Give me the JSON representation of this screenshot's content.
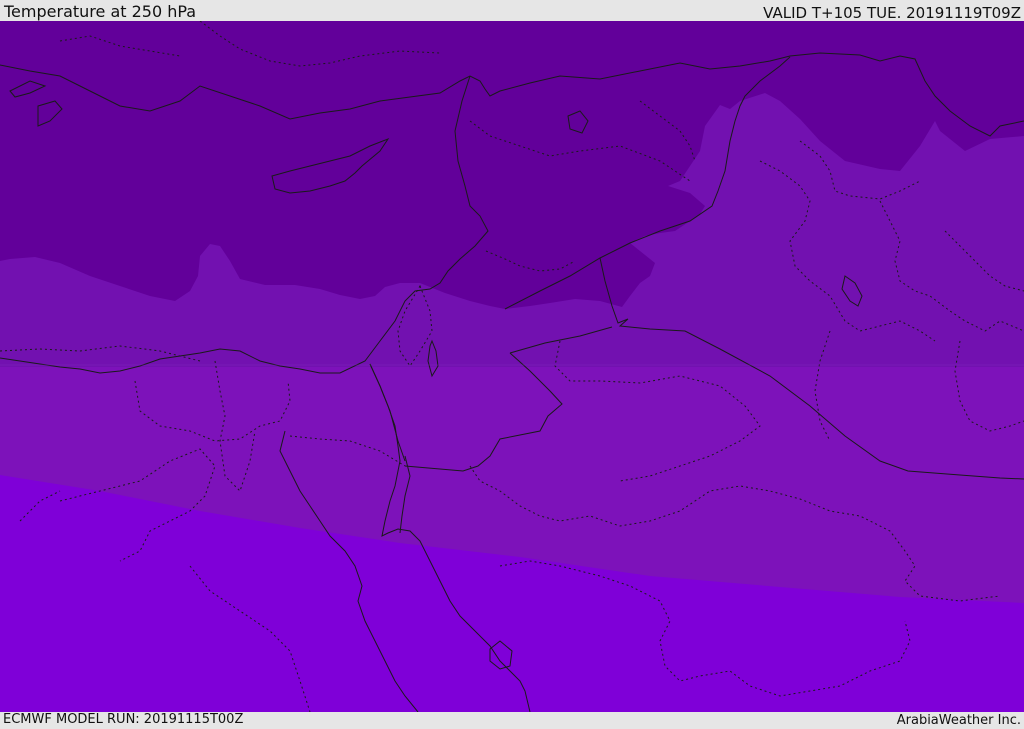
{
  "header": {
    "title": "Temperature at 250 hPa",
    "valid_time": "VALID T+105 TUE. 20191119T09Z"
  },
  "footer": {
    "model_run": "ECMWF MODEL RUN: 20191115T00Z",
    "credit": "ArabiaWeather Inc."
  },
  "map": {
    "region": "Eastern Mediterranean and Middle East",
    "field_bands": [
      {
        "name": "coldest",
        "color": "#62009a"
      },
      {
        "name": "cold",
        "color": "#7211b0"
      },
      {
        "name": "mid",
        "color": "#7d12ba"
      },
      {
        "name": "warm",
        "color": "#7f00d8"
      }
    ],
    "line_color": "#1a1a1a",
    "coastline_style": "solid",
    "internal_border_style": "dotted"
  }
}
